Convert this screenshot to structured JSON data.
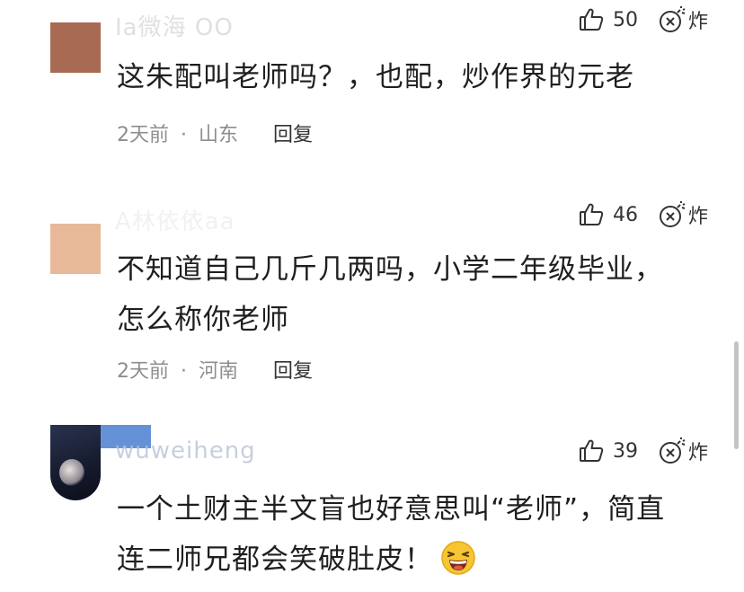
{
  "comments": [
    {
      "username": "Ia微海 OO",
      "likes": "50",
      "bomb_label": "炸",
      "text": "这朱配叫老师吗？，也配，炒作界的元老",
      "time": "2天前",
      "separator": "·",
      "location": "山东",
      "reply": "回复",
      "avatar_color": "#a86a52"
    },
    {
      "username": "A林依依aa",
      "likes": "46",
      "bomb_label": "炸",
      "text_line1": "不知道自己几斤几两吗，小学二年级毕业，",
      "text_line2": "怎么称你老师",
      "time": "2天前",
      "separator": "·",
      "location": "河南",
      "reply": "回复",
      "avatar_color": "#e8b998"
    },
    {
      "username": "wuweiheng",
      "likes": "39",
      "bomb_label": "炸",
      "text_line1": "一个土财主半文盲也好意思叫“老师”，简直",
      "text_line2": "连二师兄都会笑破肚皮！",
      "emoji": "laughing-emoji",
      "avatar_color": "#1b2440",
      "accent_color": "#4a7fd0"
    }
  ]
}
